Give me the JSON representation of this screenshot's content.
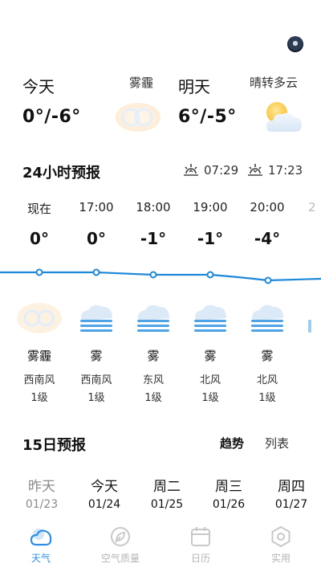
{
  "today": {
    "label": "今天",
    "condition": "雾霾",
    "temp": "0°/-6°",
    "icon": "haze-icon"
  },
  "tomorrow": {
    "label": "明天",
    "condition": "晴转多云",
    "temp": "6°/-5°",
    "icon": "sun-cloud-icon"
  },
  "hourly": {
    "title": "24小时预报",
    "sunrise": "07:29",
    "sunset": "17:23",
    "hours": [
      {
        "time": "现在",
        "temp": "0°",
        "condition": "雾霾",
        "wind": "西南风",
        "level": "1级",
        "icon": "haze-icon"
      },
      {
        "time": "17:00",
        "temp": "0°",
        "condition": "雾",
        "wind": "西南风",
        "level": "1级",
        "icon": "fog-icon"
      },
      {
        "time": "18:00",
        "temp": "-1°",
        "condition": "雾",
        "wind": "东风",
        "level": "1级",
        "icon": "fog-icon"
      },
      {
        "time": "19:00",
        "temp": "-1°",
        "condition": "雾",
        "wind": "北风",
        "level": "1级",
        "icon": "fog-icon"
      },
      {
        "time": "20:00",
        "temp": "-4°",
        "condition": "雾",
        "wind": "北风",
        "level": "1级",
        "icon": "fog-icon"
      }
    ]
  },
  "daily": {
    "title": "15日预报",
    "tab_trend": "趋势",
    "tab_list": "列表",
    "days": [
      {
        "name": "昨天",
        "date": "01/23"
      },
      {
        "name": "今天",
        "date": "01/24"
      },
      {
        "name": "周二",
        "date": "01/25"
      },
      {
        "name": "周三",
        "date": "01/26"
      },
      {
        "name": "周四",
        "date": "01/27"
      }
    ]
  },
  "nav": {
    "weather": "天气",
    "air": "空气质量",
    "calendar": "日历",
    "tools": "实用"
  },
  "colors": {
    "accent": "#2f8fe8",
    "trend_line": "#1e88d8"
  }
}
